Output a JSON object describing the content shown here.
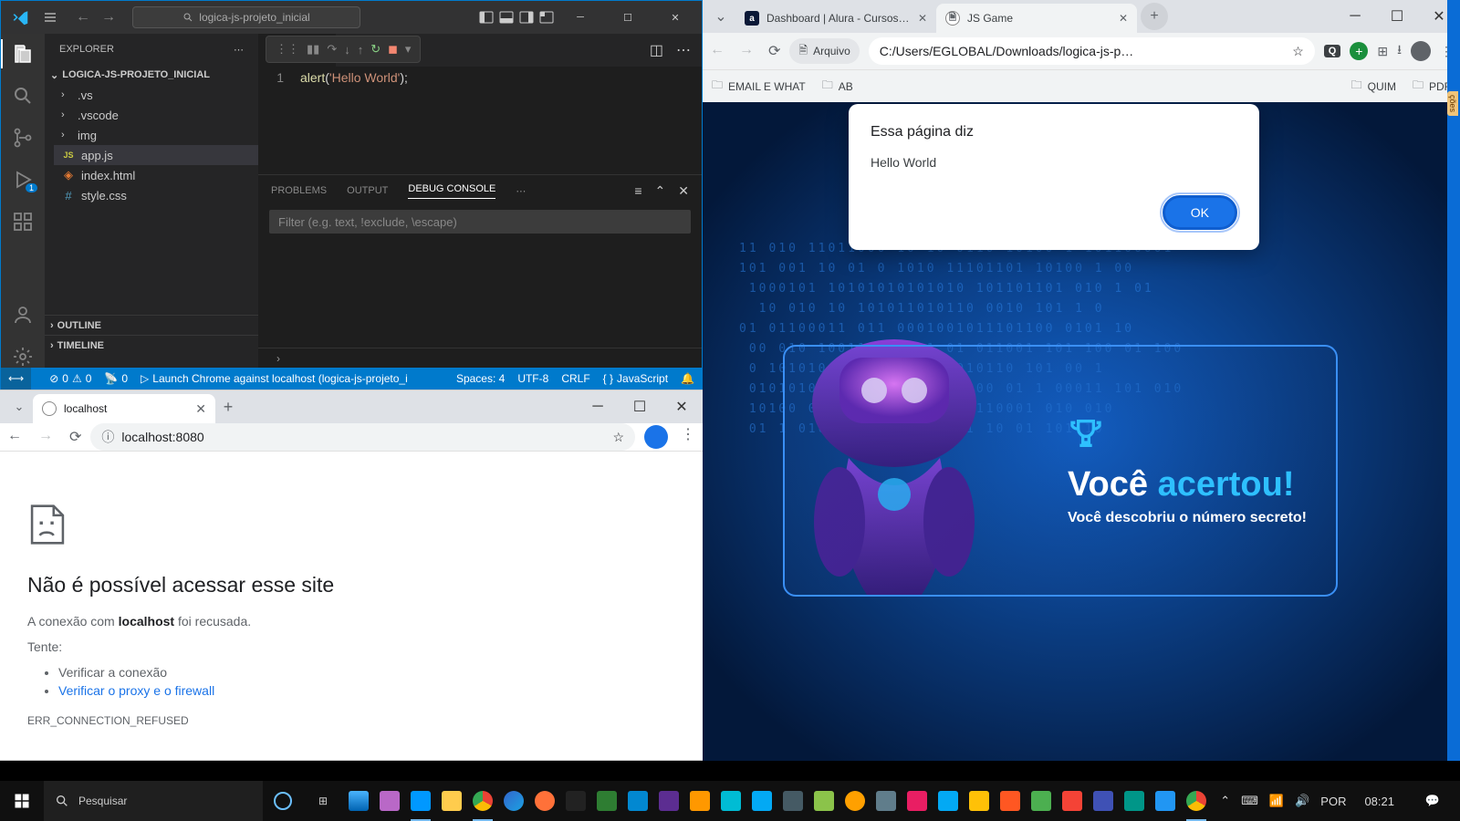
{
  "vscode": {
    "project_search": "logica-js-projeto_inicial",
    "explorer_label": "EXPLORER",
    "project_name": "LOGICA-JS-PROJETO_INICIAL",
    "tree": [
      {
        "label": ".vs",
        "type": "folder"
      },
      {
        "label": ".vscode",
        "type": "folder"
      },
      {
        "label": "img",
        "type": "folder"
      },
      {
        "label": "app.js",
        "type": "js"
      },
      {
        "label": "index.html",
        "type": "html"
      },
      {
        "label": "style.css",
        "type": "css"
      }
    ],
    "outline_label": "OUTLINE",
    "timeline_label": "TIMELINE",
    "open_tab": "app.js",
    "code_line_no": "1",
    "code_fn": "alert",
    "code_str": "'Hello World'",
    "panel": {
      "problems": "PROBLEMS",
      "output": "OUTPUT",
      "debug": "DEBUG CONSOLE",
      "filter_placeholder": "Filter (e.g. text, !exclude, \\escape)"
    },
    "status": {
      "errors": "0",
      "warnings": "0",
      "ports": "0",
      "debug": "Launch Chrome against localhost (logica-js-projeto_i",
      "spaces": "Spaces: 4",
      "encoding": "UTF-8",
      "eol": "CRLF",
      "lang": "JavaScript"
    }
  },
  "devtools": {
    "tab_title": "localhost",
    "url": "localhost:8080",
    "heading": "Não é possível acessar esse site",
    "line1_pre": "A conexão com ",
    "line1_host": "localhost",
    "line1_post": " foi recusada.",
    "try_label": "Tente:",
    "tips": [
      "Verificar a conexão",
      "Verificar o proxy e o firewall"
    ],
    "error_code": "ERR_CONNECTION_REFUSED"
  },
  "chrome": {
    "tabs": [
      {
        "title": "Dashboard | Alura - Cursos onli",
        "fav": "a"
      },
      {
        "title": "JS Game",
        "fav": "doc"
      }
    ],
    "file_chip": "Arquivo",
    "address": "C:/Users/EGLOBAL/Downloads/logica-js-p…",
    "q_badge": "Q",
    "bookmarks": [
      "EMAIL E WHAT",
      "AB",
      "QUIM",
      "PDF"
    ],
    "dialog": {
      "title": "Essa página diz",
      "message": "Hello World",
      "ok": "OK"
    },
    "game": {
      "title_a": "Você ",
      "title_b": "acertou!",
      "subtitle": "Você descobriu o número secreto!"
    }
  },
  "taskbar": {
    "search_placeholder": "Pesquisar",
    "clock": "08:21"
  }
}
